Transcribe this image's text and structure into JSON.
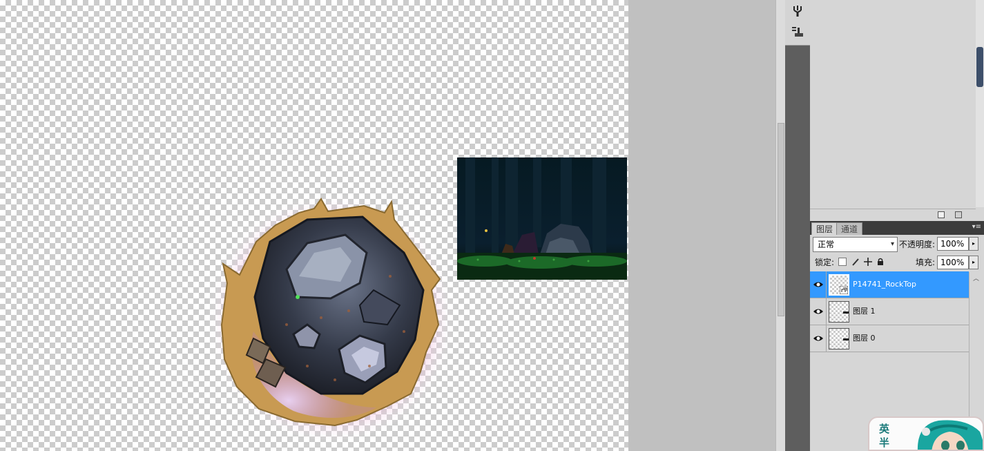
{
  "canvas": {
    "sprite_name": "rock-meteor-sprite",
    "background_preview": "dark-forest-scene"
  },
  "dock_icons": [
    "brush-preset-icon",
    "tool-preset-icon"
  ],
  "layers_panel": {
    "tabs": [
      {
        "label": "图层",
        "active": true
      },
      {
        "label": "通道",
        "active": false
      }
    ],
    "blend_mode": "正常",
    "opacity_label": "不透明度:",
    "opacity_value": "100%",
    "lock_label": "锁定:",
    "fill_label": "填充:",
    "fill_value": "100%",
    "layers": [
      {
        "name": "P14741_RockTop",
        "visible": true,
        "selected": true,
        "smart_object": true
      },
      {
        "name": "图层 1",
        "visible": true,
        "selected": false,
        "smart_object": false
      },
      {
        "name": "图层 0",
        "visible": true,
        "selected": false,
        "smart_object": false
      }
    ]
  },
  "mascot": {
    "text_line1": "英",
    "text_line2": "半"
  },
  "colors": {
    "selection": "#3399ff",
    "tab_bar": "#3c3c3c",
    "panel_bg": "#d6d6d6",
    "pasteboard": "#c0c0c0"
  }
}
